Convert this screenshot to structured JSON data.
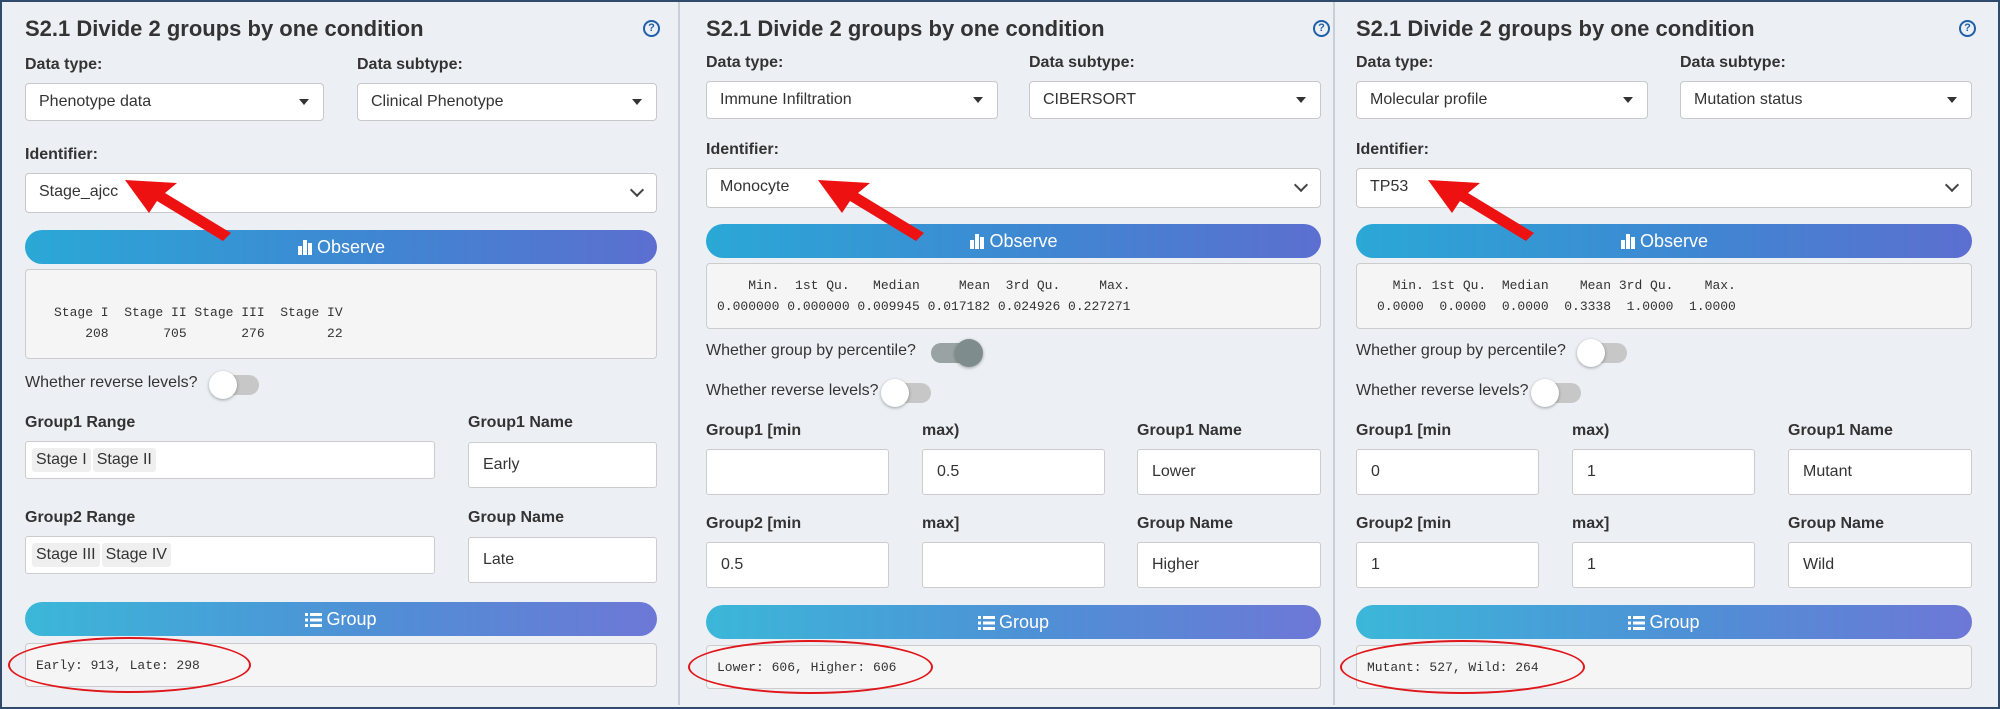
{
  "panels": [
    {
      "title": "S2.1 Divide 2 groups by one condition",
      "help": "?",
      "data_type_label": "Data type:",
      "data_type_value": "Phenotype data",
      "data_subtype_label": "Data subtype:",
      "data_subtype_value": "Clinical Phenotype",
      "identifier_label": "Identifier:",
      "identifier_value": "Stage_ajcc",
      "observe_label": "Observe",
      "summary_line1": "Stage I  Stage II Stage III  Stage IV",
      "summary_line2": "    208       705       276        22",
      "reverse_label": "Whether reverse levels?",
      "group1_range_label": "Group1 Range",
      "group1_tags": [
        "Stage I",
        "Stage II"
      ],
      "group1_name_label": "Group1 Name",
      "group1_name_value": "Early",
      "group2_range_label": "Group2 Range",
      "group2_tags": [
        "Stage III",
        "Stage IV"
      ],
      "group2_name_label": "Group Name",
      "group2_name_value": "Late",
      "group_button_label": "Group",
      "result": "Early: 913, Late: 298"
    },
    {
      "title": "S2.1 Divide 2 groups by one condition",
      "help": "?",
      "data_type_label": "Data type:",
      "data_type_value": "Immune Infiltration",
      "data_subtype_label": "Data subtype:",
      "data_subtype_value": "CIBERSORT",
      "identifier_label": "Identifier:",
      "identifier_value": "Monocyte",
      "observe_label": "Observe",
      "summary_line1": "    Min.  1st Qu.   Median     Mean  3rd Qu.     Max.",
      "summary_line2": "0.000000 0.000000 0.009945 0.017182 0.024926 0.227271",
      "percentile_label": "Whether group by percentile?",
      "reverse_label": "Whether reverse levels?",
      "group1_min_label": "Group1 [min",
      "group1_max_label": "max)",
      "group1_min_value": "",
      "group1_max_value": "0.5",
      "group1_name_label": "Group1 Name",
      "group1_name_value": "Lower",
      "group2_min_label": "Group2 [min",
      "group2_max_label": "max]",
      "group2_min_value": "0.5",
      "group2_max_value": "",
      "group2_name_label": "Group Name",
      "group2_name_value": "Higher",
      "group_button_label": "Group",
      "result": "Lower: 606, Higher: 606"
    },
    {
      "title": "S2.1 Divide 2 groups by one condition",
      "help": "?",
      "data_type_label": "Data type:",
      "data_type_value": "Molecular profile",
      "data_subtype_label": "Data subtype:",
      "data_subtype_value": "Mutation status",
      "identifier_label": "Identifier:",
      "identifier_value": "TP53",
      "observe_label": "Observe",
      "summary_line1": "  Min. 1st Qu.  Median    Mean 3rd Qu.    Max.",
      "summary_line2": "0.0000  0.0000  0.0000  0.3338  1.0000  1.0000",
      "percentile_label": "Whether group by percentile?",
      "reverse_label": "Whether reverse levels?",
      "group1_min_label": "Group1 [min",
      "group1_max_label": "max)",
      "group1_min_value": "0",
      "group1_max_value": "1",
      "group1_name_label": "Group1 Name",
      "group1_name_value": "Mutant",
      "group2_min_label": "Group2 [min",
      "group2_max_label": "max]",
      "group2_min_value": "1",
      "group2_max_value": "1",
      "group2_name_label": "Group Name",
      "group2_name_value": "Wild",
      "group_button_label": "Group",
      "result": "Mutant: 527, Wild: 264"
    }
  ],
  "toggles": {
    "panel1_reverse": false,
    "panel2_percentile": true,
    "panel2_reverse": false,
    "panel3_percentile": false,
    "panel3_reverse": false
  },
  "colors": {
    "button_start": "#2aa8d6",
    "button_end": "#5c6fd0",
    "annotation_red": "#e0161a",
    "help_blue": "#1f5fa8"
  },
  "icons": {
    "observe": "bar-chart-icon",
    "group": "list-icon",
    "annotation": "red-arrow-icon"
  }
}
